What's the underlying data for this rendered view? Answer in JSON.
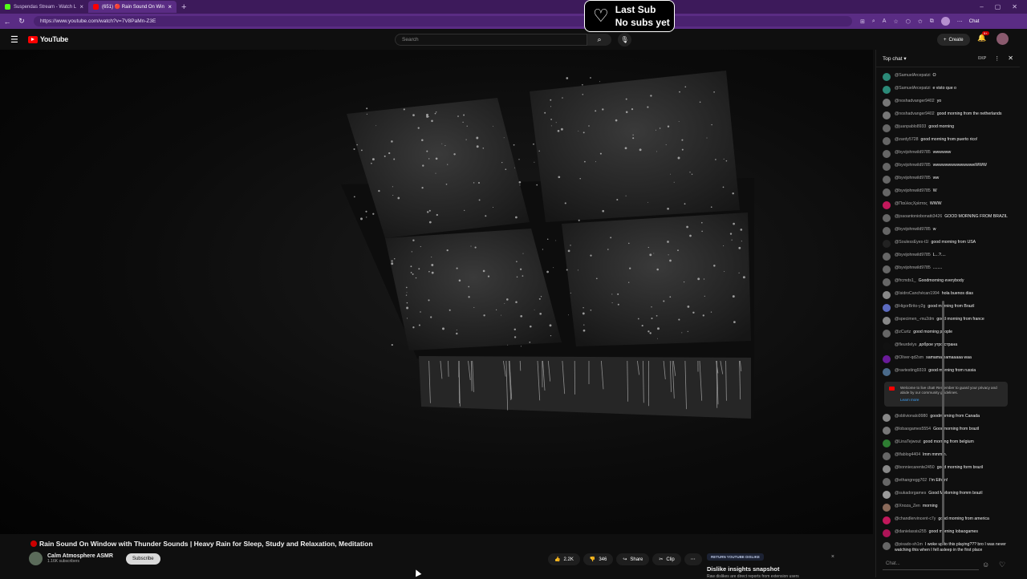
{
  "browser": {
    "tabs": [
      {
        "label": "Suspendas Stream - Watch L",
        "fav": "#53fc18"
      },
      {
        "label": "(651) 🔴 Rain Sound On Win",
        "fav": "#ff0000"
      }
    ],
    "url": "https://www.youtube.com/watch?v=7V8PaMn-Z3E",
    "chat_label": "Chat"
  },
  "overlay": {
    "line1": "Last Sub",
    "line2": "No subs yet"
  },
  "youtube": {
    "logo": "YouTube",
    "search_placeholder": "Search",
    "create_label": "Create",
    "notif_count": "9+"
  },
  "video": {
    "title": "Rain Sound On Window with Thunder Sounds | Heavy Rain for Sleep, Study and Relaxation, Meditation",
    "channel": "Calm Atmosphere ASMR",
    "subscribers": "1.16K subscribers",
    "subscribe_label": "Subscribe",
    "likes": "2.2K",
    "dislikes": "346",
    "share_label": "Share",
    "clip_label": "Clip"
  },
  "dislike_card": {
    "tag": "RETURN YOUTUBE DISLIKE",
    "heading": "Dislike insights snapshot",
    "sub": "Raw dislikes are direct reports from extension users"
  },
  "chat": {
    "header": "Top chat",
    "xp": "0XP",
    "input_placeholder": "Chat...",
    "notice": "Welcome to live chat! Remember to guard your privacy and abide by our community guidelines.",
    "learn_more": "Learn more",
    "messages_before": [
      {
        "user": "@SamuelArcepatzi",
        "text": "O",
        "color": "#2b8a78"
      },
      {
        "user": "@SamuelArcepatzi",
        "text": "e visto que o",
        "color": "#2b8a78"
      },
      {
        "user": "@noshadvanger9402",
        "text": "yo",
        "color": "#777"
      },
      {
        "user": "@noshadvanger9402",
        "text": "good morning from the netherlands",
        "color": "#777"
      },
      {
        "user": "@juanpablo8933",
        "text": "good morning",
        "color": "#666"
      },
      {
        "user": "@zardy5728",
        "text": "good morning from puerto rico!",
        "color": "#666"
      },
      {
        "user": "@byvijohnwild9785",
        "text": "wwwwww",
        "color": "#666"
      },
      {
        "user": "@byvijohnwild9785",
        "text": "wwwwwwwwwwwwwwWWW",
        "color": "#666"
      },
      {
        "user": "@byvijohnwild9785",
        "text": "ww",
        "color": "#666"
      },
      {
        "user": "@byvijohnwild9785",
        "text": "W",
        "color": "#666"
      },
      {
        "user": "@ΠαύλοςΧρίστος",
        "text": "WWW",
        "color": "#c2185b"
      },
      {
        "user": "@joaoantoniobonatti3426",
        "text": "GOOD MORNING FROM BRAZIL",
        "color": "#666"
      },
      {
        "user": "@byvijohnwild9785",
        "text": "w",
        "color": "#666"
      },
      {
        "user": "@SoulessEyes-t1l",
        "text": "good morning from USA",
        "color": "#222"
      },
      {
        "user": "@byvijohnwild9785",
        "text": "L...?....",
        "color": "#666"
      },
      {
        "user": "@byvijohnwild9785",
        "text": "........",
        "color": "#666"
      },
      {
        "user": "@frcmds1_",
        "text": "Goodmorning everybody",
        "color": "#666"
      },
      {
        "user": "@IsidroCanchécan1994",
        "text": "hola buenos dias",
        "color": "#888"
      },
      {
        "user": "@HigorBrito-y2g",
        "text": "good morning from Brazil",
        "color": "#5c6bc0"
      },
      {
        "user": "@specimen_-mu2dm",
        "text": "good morning from france",
        "color": "#888"
      },
      {
        "user": "@zCurtz",
        "text": "good morning people",
        "color": "#666"
      },
      {
        "user": "@fleurdelys",
        "text": "доброе утро страна",
        "color": "#111"
      },
      {
        "user": "@Oliver-qd2sm",
        "text": "samamamamaaaaa waa",
        "color": "#6a1b9a"
      },
      {
        "user": "@ravtesting9319",
        "text": "good morning from russia",
        "color": "#4a6a8a"
      }
    ],
    "messages_after": [
      {
        "user": "@oblivionalo9980",
        "text": "goodmorning from Canada",
        "color": "#888"
      },
      {
        "user": "@lobaogames5554",
        "text": "Goodmorning from brazil",
        "color": "#777"
      },
      {
        "user": "@LinaTejwout",
        "text": "good morning from belgium",
        "color": "#2e7d32"
      },
      {
        "user": "@lfablog4404",
        "text": "lmm mmmm.",
        "color": "#666"
      },
      {
        "user": "@bonniecarente2450",
        "text": "good morning form brazil",
        "color": "#888"
      },
      {
        "user": "@ethangregg702",
        "text": "I'm Ethan!",
        "color": "#666"
      },
      {
        "user": "@sukadorgames",
        "text": "Good MMorning fromm brazil",
        "color": "#999"
      },
      {
        "user": "@Xnoza_Zen",
        "text": "morning",
        "color": "#8a6a5a"
      },
      {
        "user": "@chandlervincent-c7y",
        "text": "good morning from america",
        "color": "#c2185b"
      },
      {
        "user": "@danielassis255",
        "text": "good morning lobaogames",
        "color": "#ad1457"
      },
      {
        "user": "@pixado-sh1m",
        "text": "I woke up to this playing??? bro I was never watching this when I fell asleep in the first place",
        "color": "#666"
      },
      {
        "user": "@DarylNguyen-n8",
        "text": "same I woke up with this playing",
        "color": "#888"
      },
      {
        "user": "@lindseelang9334",
        "text": "goodnight from indonesia",
        "color": "#3949ab"
      }
    ]
  }
}
